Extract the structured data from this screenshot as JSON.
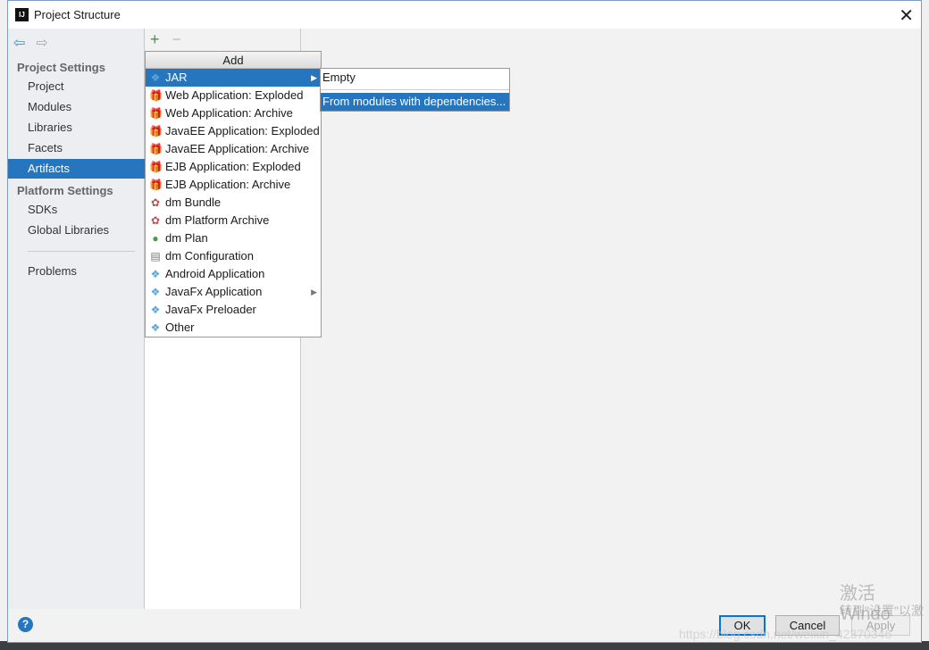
{
  "window": {
    "title": "Project Structure",
    "logo": "IJ"
  },
  "sidebar": {
    "project_settings": "Project Settings",
    "project_items": [
      {
        "label": "Project"
      },
      {
        "label": "Modules"
      },
      {
        "label": "Libraries"
      },
      {
        "label": "Facets"
      },
      {
        "label": "Artifacts",
        "selected": true
      }
    ],
    "platform_settings": "Platform Settings",
    "platform_items": [
      {
        "label": "SDKs"
      },
      {
        "label": "Global Libraries"
      }
    ],
    "problems": "Problems"
  },
  "popup": {
    "header": "Add",
    "items": [
      {
        "label": "JAR",
        "icon": "diamond-icon",
        "submenu": true,
        "selected": true
      },
      {
        "label": "Web Application: Exploded",
        "icon": "web-app-icon"
      },
      {
        "label": "Web Application: Archive",
        "icon": "web-app-icon"
      },
      {
        "label": "JavaEE Application: Exploded",
        "icon": "javaee-icon"
      },
      {
        "label": "JavaEE Application: Archive",
        "icon": "javaee-icon"
      },
      {
        "label": "EJB Application: Exploded",
        "icon": "ejb-icon"
      },
      {
        "label": "EJB Application: Archive",
        "icon": "ejb-icon"
      },
      {
        "label": "dm Bundle",
        "icon": "bundle-icon"
      },
      {
        "label": "dm Platform Archive",
        "icon": "bundle-icon"
      },
      {
        "label": "dm Plan",
        "icon": "plan-icon"
      },
      {
        "label": "dm Configuration",
        "icon": "config-icon"
      },
      {
        "label": "Android Application",
        "icon": "diamond-icon"
      },
      {
        "label": "JavaFx Application",
        "icon": "diamond-icon",
        "submenu": true
      },
      {
        "label": "JavaFx Preloader",
        "icon": "diamond-icon"
      },
      {
        "label": "Other",
        "icon": "diamond-icon"
      }
    ]
  },
  "submenu": {
    "items": [
      {
        "label": "Empty"
      },
      {
        "label": "From modules with dependencies...",
        "selected": true
      }
    ]
  },
  "buttons": {
    "ok": "OK",
    "cancel": "Cancel",
    "apply": "Apply",
    "help": "?"
  },
  "watermark": {
    "activate": "激活 Windo",
    "settings": "转到\"设置\"以激",
    "url": "https://blog.csdn.net/weixin_42370346"
  },
  "colors": {
    "selection": "#2675bf",
    "add": "#3c9a3c"
  }
}
